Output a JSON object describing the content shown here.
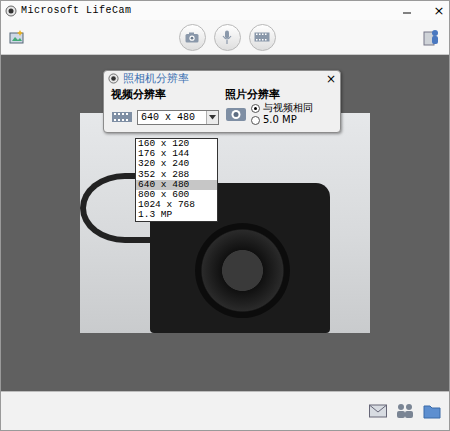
{
  "window": {
    "title": "Microsoft LifeCam",
    "close": "×"
  },
  "dialog": {
    "title": "照相机分辨率",
    "close": "×",
    "video": {
      "label": "视频分辨率",
      "value": "640 x 480",
      "expanded": true,
      "options": [
        {
          "label": "160 x 120",
          "selected": false
        },
        {
          "label": "176 x 144",
          "selected": false
        },
        {
          "label": "320 x 240",
          "selected": false
        },
        {
          "label": "352 x 288",
          "selected": false
        },
        {
          "label": "640 x 480",
          "selected": true
        },
        {
          "label": "800 x 600",
          "selected": false
        },
        {
          "label": "1024 x 768",
          "selected": false
        },
        {
          "label": "1.3 MP",
          "selected": false
        }
      ]
    },
    "photo": {
      "label": "照片分辨率",
      "options": [
        {
          "label": "与视频相同",
          "selected": true
        },
        {
          "label": "5.0 MP",
          "selected": false
        }
      ]
    }
  }
}
